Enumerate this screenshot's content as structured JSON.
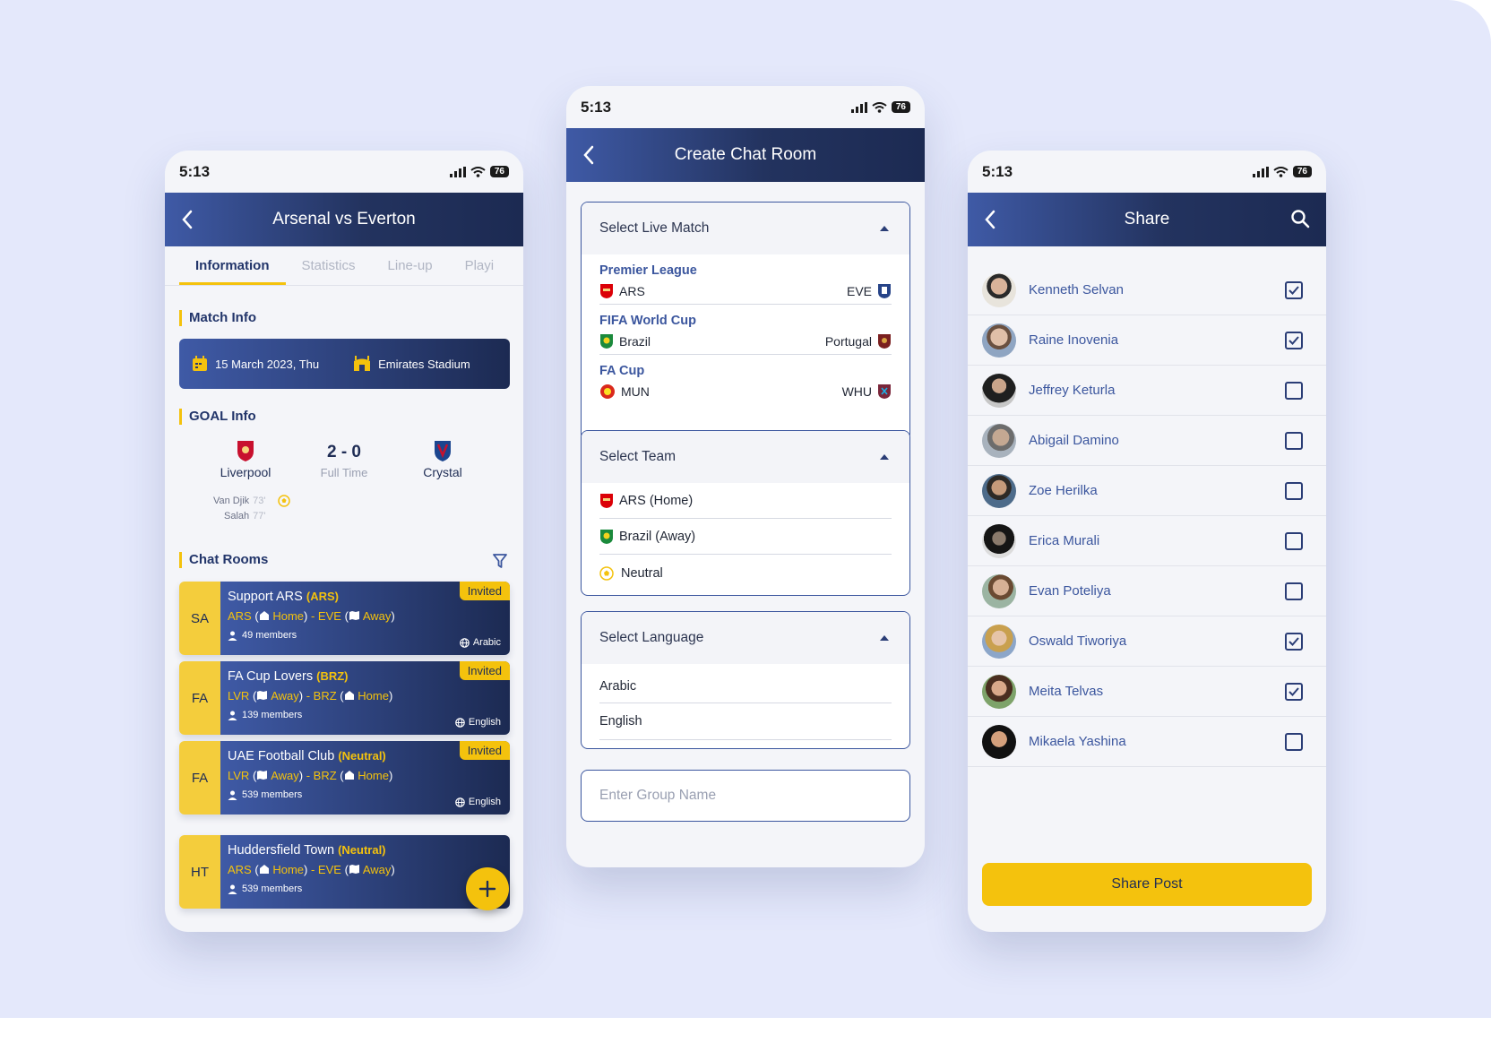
{
  "colors": {
    "accent": "#f4c20d",
    "primary": "#3b569e",
    "navy": "#1c2a52",
    "background": "#e4e8fb"
  },
  "status": {
    "time": "5:13",
    "battery": "76"
  },
  "screen1": {
    "title": "Arsenal vs Everton",
    "tabs": [
      "Information",
      "Statistics",
      "Line-up",
      "Playi"
    ],
    "match_info_title": "Match Info",
    "date": "15 March 2023, Thu",
    "stadium": "Emirates Stadium",
    "goal_info_title": "GOAL Info",
    "home_team": "Liverpool",
    "away_team": "Crystal",
    "score": "2 - 0",
    "score_status": "Full Time",
    "scorers": [
      {
        "name": "Van Djik",
        "minute": "73'"
      },
      {
        "name": "Salah",
        "minute": "77'"
      }
    ],
    "chat_rooms_title": "Chat Rooms",
    "rooms": [
      {
        "abbr": "SA",
        "name": "Support ARS",
        "tag": "(ARS)",
        "t1": "ARS",
        "t1_side": "Home",
        "t2": "EVE",
        "t2_side": "Away",
        "members": "49 members",
        "lang": "Arabic",
        "badge": "Invited"
      },
      {
        "abbr": "FA",
        "name": "FA Cup Lovers",
        "tag": "(BRZ)",
        "t1": "LVR",
        "t1_side": "Away",
        "t2": "BRZ",
        "t2_side": "Home",
        "members": "139 members",
        "lang": "English",
        "badge": "Invited"
      },
      {
        "abbr": "FA",
        "name": "UAE Football Club",
        "tag": "(Neutral)",
        "t1": "LVR",
        "t1_side": "Away",
        "t2": "BRZ",
        "t2_side": "Home",
        "members": "539 members",
        "lang": "English",
        "badge": "Invited"
      },
      {
        "abbr": "HT",
        "name": "Huddersfield Town",
        "tag": "(Neutral)",
        "t1": "ARS",
        "t1_side": "Home",
        "t2": "EVE",
        "t2_side": "Away",
        "members": "539 members",
        "lang": "",
        "badge": ""
      }
    ]
  },
  "screen2": {
    "title": "Create Chat Room",
    "live_match_label": "Select Live Match",
    "leagues": [
      {
        "name": "Premier League",
        "home": "ARS",
        "away": "EVE"
      },
      {
        "name": "FIFA World Cup",
        "home": "Brazil",
        "away": "Portugal"
      },
      {
        "name": "FA Cup",
        "home": "MUN",
        "away": "WHU"
      }
    ],
    "team_label": "Select Team",
    "teams": [
      "ARS (Home)",
      "Brazil (Away)",
      "Neutral"
    ],
    "language_label": "Select Language",
    "languages": [
      "Arabic",
      "English"
    ],
    "group_name_placeholder": "Enter Group Name"
  },
  "screen3": {
    "title": "Share",
    "contacts": [
      {
        "name": "Kenneth Selvan",
        "checked": true
      },
      {
        "name": "Raine Inovenia",
        "checked": true
      },
      {
        "name": "Jeffrey Keturla",
        "checked": false
      },
      {
        "name": "Abigail Damino",
        "checked": false
      },
      {
        "name": "Zoe Herilka",
        "checked": false
      },
      {
        "name": "Erica Murali",
        "checked": false
      },
      {
        "name": "Evan Poteliya",
        "checked": false
      },
      {
        "name": "Oswald Tiworiya",
        "checked": true
      },
      {
        "name": "Meita Telvas",
        "checked": true
      },
      {
        "name": "Mikaela Yashina",
        "checked": false
      }
    ],
    "share_button": "Share Post"
  }
}
